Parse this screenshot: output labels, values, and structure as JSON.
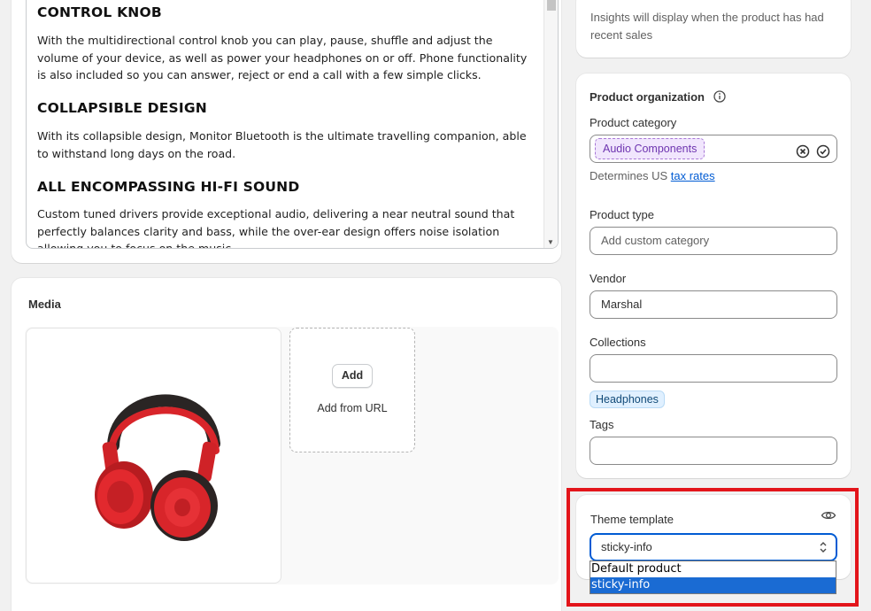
{
  "description": {
    "sections": [
      {
        "heading": "CONTROL KNOB",
        "body": "With the multidirectional control knob you can play, pause, shuffle and adjust the volume of your device, as well as power your headphones on or off. Phone functionality is also included so you can answer, reject or end a call with a few simple clicks."
      },
      {
        "heading": "COLLAPSIBLE DESIGN",
        "body": "With its collapsible design, Monitor Bluetooth is the ultimate travelling companion, able to withstand long days on the road."
      },
      {
        "heading": "ALL ENCOMPASSING HI-FI SOUND",
        "body": "Custom tuned drivers provide exceptional audio, delivering a near neutral sound that perfectly balances clarity and bass, while the over-ear design offers noise isolation allowing you to focus on the music."
      }
    ]
  },
  "media": {
    "title": "Media",
    "add_label": "Add",
    "add_from_url_label": "Add from URL",
    "image_name": "headphones-image"
  },
  "insights": {
    "text": "Insights will display when the product has had recent sales"
  },
  "organization": {
    "title": "Product organization",
    "category_label": "Product category",
    "category_value": "Audio Components",
    "tax_prefix": "Determines US",
    "tax_link": "tax rates",
    "type_label": "Product type",
    "type_placeholder": "Add custom category",
    "vendor_label": "Vendor",
    "vendor_value": "Marshal",
    "collections_label": "Collections",
    "collections_value": "",
    "collection_tag": "Headphones",
    "tags_label": "Tags",
    "tags_value": ""
  },
  "theme": {
    "label": "Theme template",
    "selected": "sticky-info",
    "options": [
      "Default product",
      "sticky-info"
    ],
    "highlight_color": "#e3151b"
  }
}
